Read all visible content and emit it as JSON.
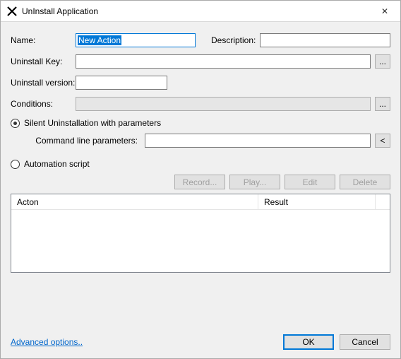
{
  "window": {
    "title": "UnInstall Application"
  },
  "labels": {
    "name": "Name:",
    "description": "Description:",
    "uninstall_key": "Uninstall Key:",
    "uninstall_version": "Uninstall version:",
    "conditions": "Conditions:"
  },
  "fields": {
    "name_value": "New Action",
    "description_value": "",
    "uninstall_key_value": "",
    "uninstall_version_value": "",
    "conditions_value": "",
    "cmdline_value": ""
  },
  "radios": {
    "silent": "Silent Uninstallation with parameters",
    "automation": "Automation script"
  },
  "param": {
    "label": "Command line parameters:"
  },
  "buttons": {
    "ellipsis": "...",
    "angle": "<",
    "record": "Record...",
    "play": "Play...",
    "edit": "Edit",
    "delete": "Delete",
    "ok": "OK",
    "cancel": "Cancel"
  },
  "table": {
    "col_acton": "Acton",
    "col_result": "Result"
  },
  "footer": {
    "advanced": "Advanced options.."
  }
}
